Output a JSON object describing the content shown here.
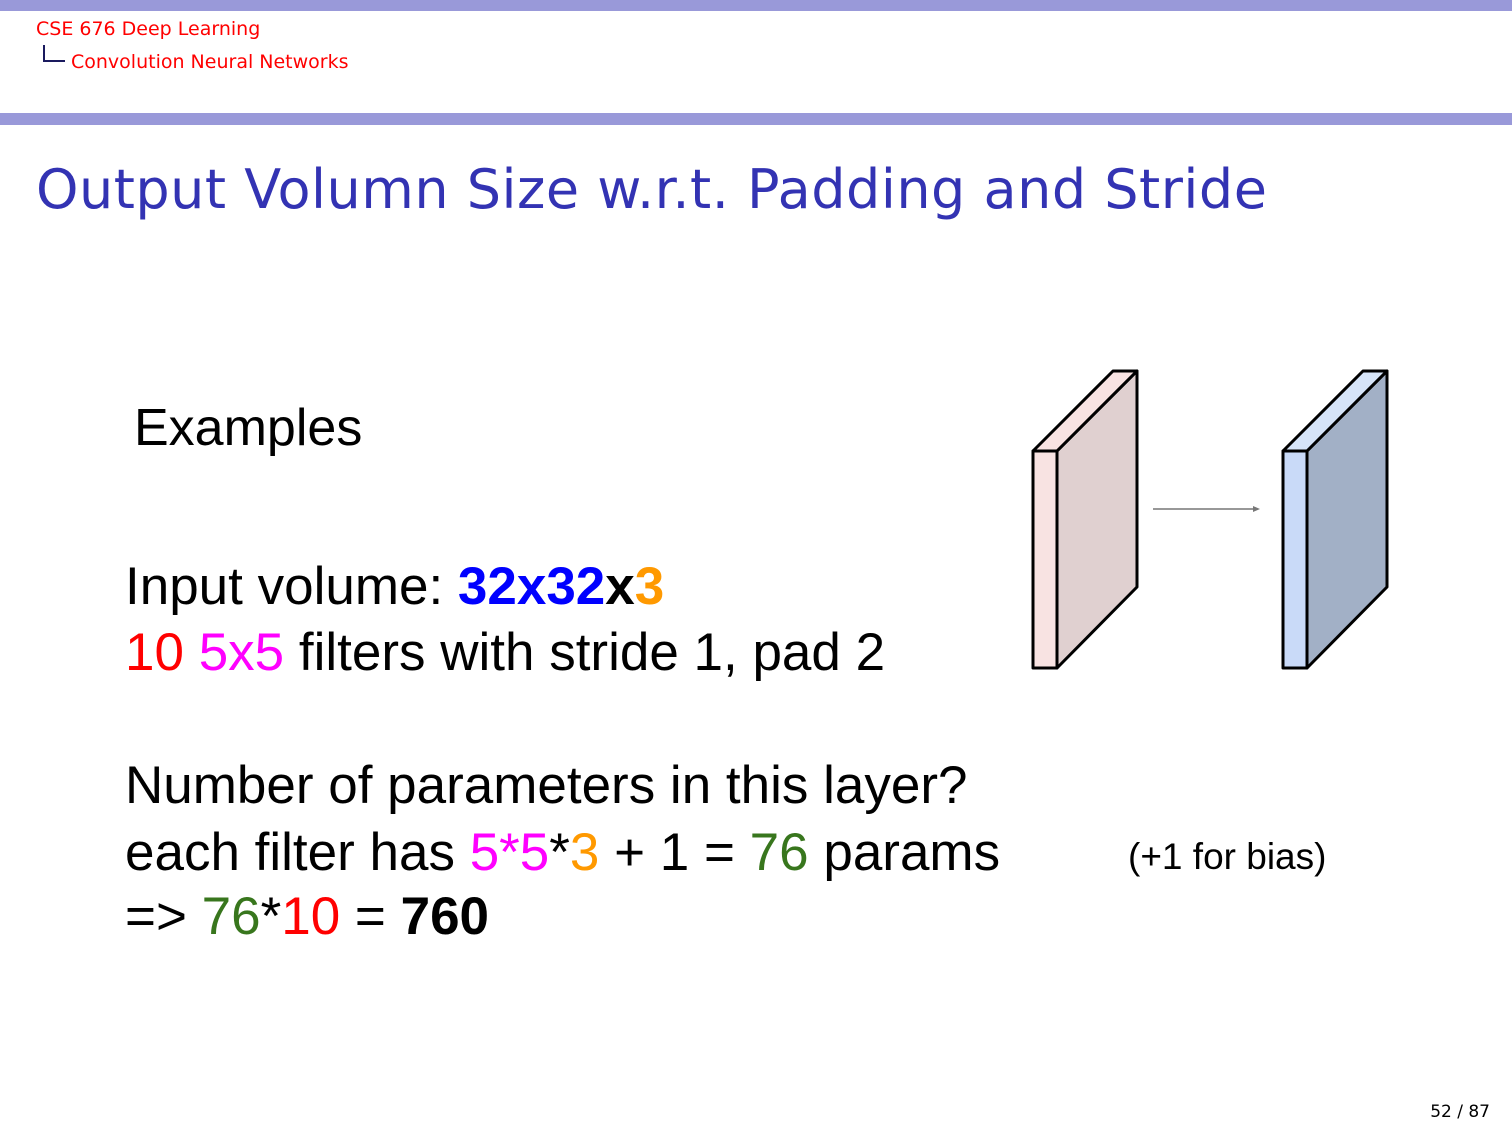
{
  "header": {
    "course": "CSE 676 Deep Learning",
    "section": "Convolution Neural Networks"
  },
  "title": "Output Volumn Size w.r.t. Padding and Stride",
  "body": {
    "examples": "Examples",
    "input_line": {
      "label": "Input volume: ",
      "dim1": "32x32",
      "x": "x",
      "depth": "3"
    },
    "filter_line": {
      "count": "10",
      "size": "5x5",
      "rest": " filters with stride 1, pad 2"
    },
    "question": "Number of parameters in this layer?",
    "each_line": {
      "prefix": "each filter has ",
      "p1": "5*5",
      "star": "*",
      "p2": "3",
      "mid": " + 1 = ",
      "result": "76",
      "suffix": " params"
    },
    "total_line": {
      "prefix": "=> ",
      "a": "76",
      "star": "*",
      "b": "10",
      "eq": " = ",
      "total": "760"
    },
    "note": "(+1 for bias)"
  },
  "diagram": {
    "input_front": "#f8e3e2",
    "input_side": "#e0d0d0",
    "output_front": "#c9daf8",
    "output_side": "#a2b0c6",
    "arrow": "#777777"
  },
  "colors": {
    "blue": "#0000ff",
    "orange": "#ff9900",
    "red": "#ff0000",
    "magenta": "#ff00ff",
    "green": "#38761d"
  },
  "page": "52 / 87"
}
